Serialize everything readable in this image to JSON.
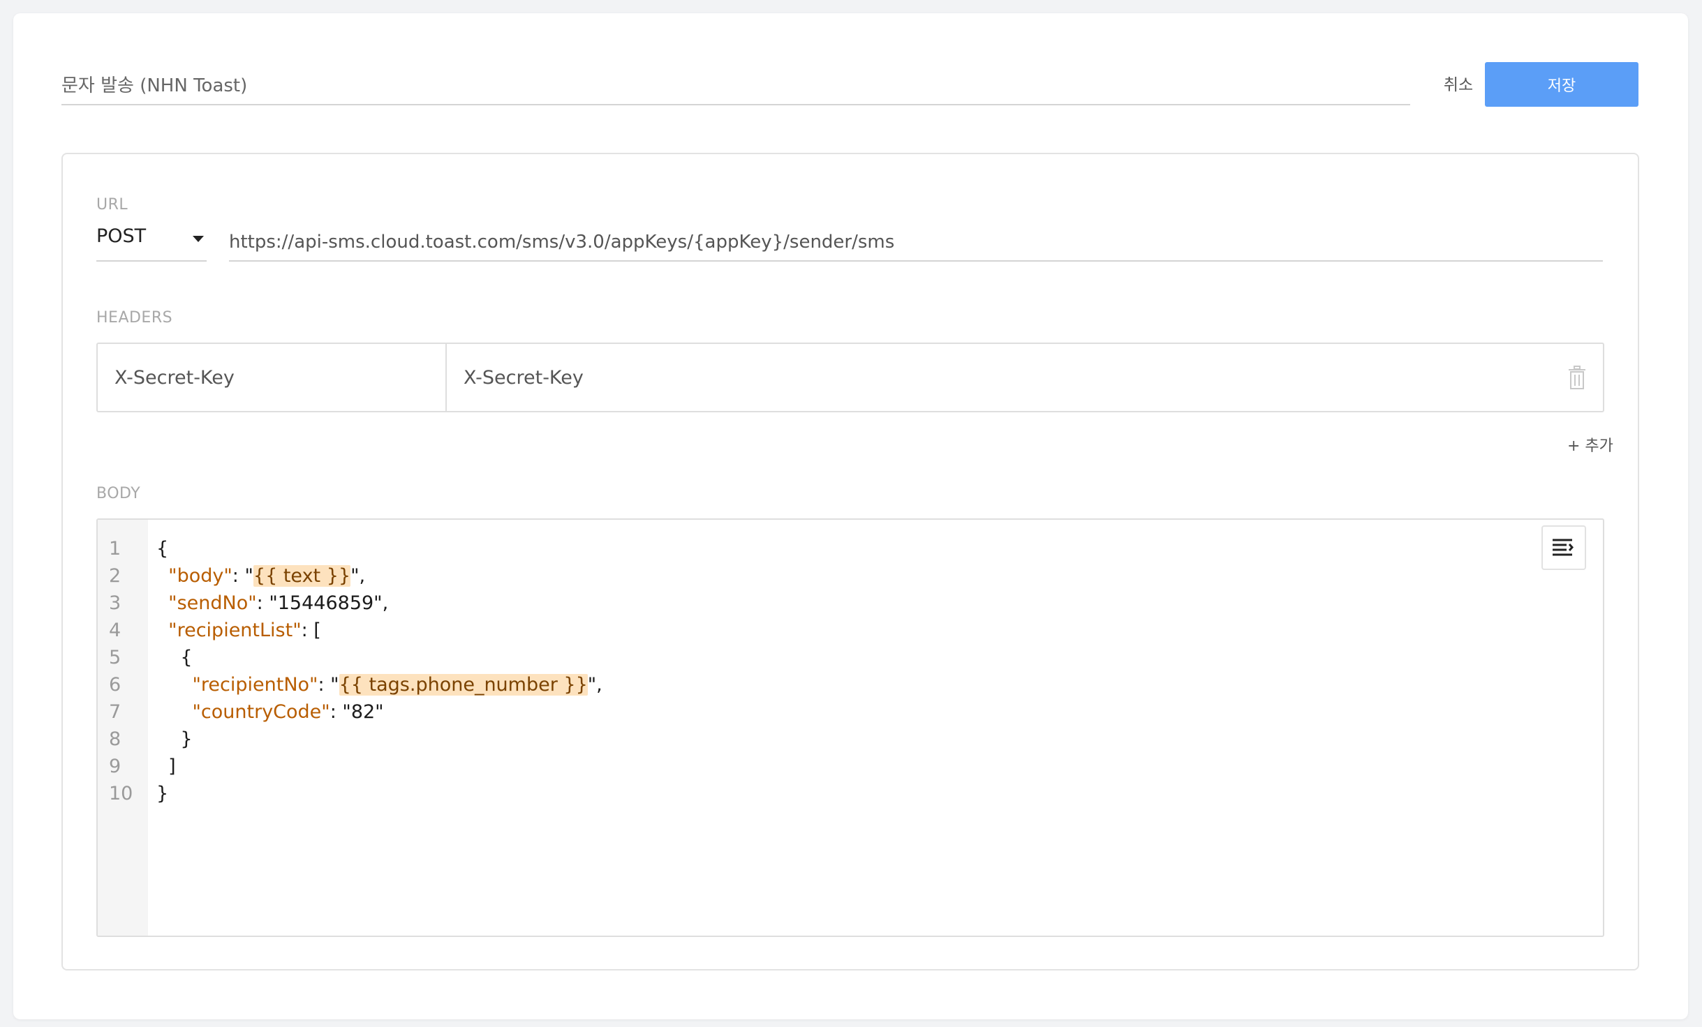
{
  "header": {
    "title_value": "문자 발송 (NHN Toast)",
    "cancel_label": "취소",
    "save_label": "저장"
  },
  "url_section": {
    "label": "URL",
    "method": "POST",
    "url": "https://api-sms.cloud.toast.com/sms/v3.0/appKeys/{appKey}/sender/sms"
  },
  "headers_section": {
    "label": "HEADERS",
    "rows": [
      {
        "key": "X-Secret-Key",
        "value": "X-Secret-Key"
      }
    ],
    "add_label": "+ 추가"
  },
  "body_section": {
    "label": "BODY",
    "line_numbers": [
      "1",
      "2",
      "3",
      "4",
      "5",
      "6",
      "7",
      "8",
      "9",
      "10"
    ],
    "lines": [
      {
        "parts": [
          {
            "t": "{",
            "c": ""
          }
        ]
      },
      {
        "parts": [
          {
            "t": "  ",
            "c": ""
          },
          {
            "t": "\"body\"",
            "c": "k"
          },
          {
            "t": ": \"",
            "c": ""
          },
          {
            "t": "{{ text }}",
            "c": "hl"
          },
          {
            "t": "\",",
            "c": ""
          }
        ]
      },
      {
        "parts": [
          {
            "t": "  ",
            "c": ""
          },
          {
            "t": "\"sendNo\"",
            "c": "k"
          },
          {
            "t": ": \"15446859\",",
            "c": ""
          }
        ]
      },
      {
        "parts": [
          {
            "t": "  ",
            "c": ""
          },
          {
            "t": "\"recipientList\"",
            "c": "k"
          },
          {
            "t": ": [",
            "c": ""
          }
        ]
      },
      {
        "parts": [
          {
            "t": "    {",
            "c": ""
          }
        ]
      },
      {
        "parts": [
          {
            "t": "      ",
            "c": ""
          },
          {
            "t": "\"recipientNo\"",
            "c": "k"
          },
          {
            "t": ": \"",
            "c": ""
          },
          {
            "t": "{{ tags.phone_number }}",
            "c": "hl"
          },
          {
            "t": "\",",
            "c": ""
          }
        ]
      },
      {
        "parts": [
          {
            "t": "      ",
            "c": ""
          },
          {
            "t": "\"countryCode\"",
            "c": "k"
          },
          {
            "t": ": \"82\"",
            "c": ""
          }
        ]
      },
      {
        "parts": [
          {
            "t": "    }",
            "c": ""
          }
        ]
      },
      {
        "parts": [
          {
            "t": "  ]",
            "c": ""
          }
        ]
      },
      {
        "parts": [
          {
            "t": "}",
            "c": ""
          }
        ]
      }
    ],
    "format_icon": "format-align-icon"
  },
  "colors": {
    "accent": "#5b9ef7",
    "json_key": "#b85d00",
    "template_highlight": "#fde2be"
  }
}
